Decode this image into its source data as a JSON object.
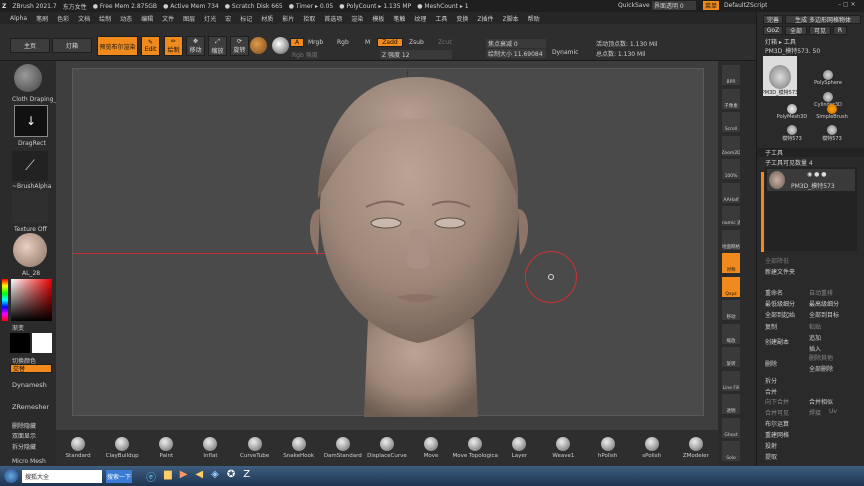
{
  "title_bar": {
    "title": "ZBrush 2021.7",
    "doc_name": "东方女性",
    "free_mem": "● Free Mem 2.875GB",
    "active_mem": "● Active Mem 734",
    "scratch_disk": "● Scratch Disk 665",
    "timer": "● Timer ▸ 0.05",
    "poly_count": "● PolyCount ▸ 1.135 MP",
    "mesh_count": "● MeshCount ▸ 1",
    "quicksave": "QuickSave",
    "interface_transparency": "界面透明 0",
    "menu_label": "菜单",
    "default_zscript": "DefaultZScript"
  },
  "menus": [
    "Alpha",
    "笔刷",
    "色彩",
    "文档",
    "绘制",
    "动态",
    "编辑",
    "文件",
    "图层",
    "灯光",
    "宏",
    "标记",
    "材质",
    "影片",
    "拾取",
    "首选项",
    "渲染",
    "模板",
    "笔触",
    "纹理",
    "工具",
    "变换",
    "Z插件",
    "Z脚本",
    "帮助"
  ],
  "toolbar": {
    "home": "主页",
    "lightbox": "灯箱",
    "preview_bool": "预览布尔渲染",
    "edit": "Edit",
    "draw": "绘制",
    "move": "移动",
    "scale": "缩放",
    "rotate": "旋转",
    "a": "A",
    "mrgb": "Mrgb",
    "rgb": "Rgb",
    "m": "M",
    "zadd": "Zadd",
    "zsub": "Zsub",
    "zcut": "Zcut",
    "rgb_intensity": "Rgb 强度",
    "z_intensity": "Z 强度 12",
    "focal_shift": "焦点衰减 0",
    "draw_size": "绘制大小 11.69084",
    "dynamic": "Dynamic",
    "active_points": "活动顶点数: 1.130 Mil",
    "total_points": "总点数: 1.130 Mil"
  },
  "left_panel": {
    "material": "Cloth Draping_T",
    "stroke": "DragRect",
    "alpha": "~BrushAlpha",
    "texture": "Texture Off",
    "material2": "AL_28",
    "gradient": "渐变",
    "switch_color": "切换颜色",
    "alternate": "交替",
    "dynamesh": "Dynamesh",
    "zremesher": "ZRemesher",
    "delete_hidden": "删除隐藏",
    "double_display": "双面显示",
    "split_hidden": "拆分隐藏",
    "micro_mesh": "Micro Mesh"
  },
  "right_toolbar": [
    "BPR",
    "子像素",
    "Scroll",
    "Zoom2D",
    "100%",
    "AAHalf",
    "Dynamic 透视",
    "地面网格",
    "对称",
    "Qxyz",
    "移动",
    "缩放",
    "旋转",
    "Line Fill",
    "透明",
    "Ghost",
    "Solo"
  ],
  "tool_panel": {
    "complete": "完善",
    "gen_multi": "生成 多边形网格物体",
    "goz": "GoZ",
    "all": "全部",
    "visible": "可见",
    "r": "R",
    "lightbox_tool": "灯箱 ▸ 工具",
    "current_tool": "PM3D_模特573. 50",
    "slider_value": "50",
    "tools": [
      {
        "name": "PM3D_模特573",
        "icon": "head"
      },
      {
        "name": "PolySphere",
        "icon": "sphere"
      },
      {
        "name": "Cylinder3D",
        "icon": "cylinder"
      },
      {
        "name": "PolyMesh3D",
        "icon": "star"
      },
      {
        "name": "SimpleBrush",
        "icon": "s-brush"
      },
      {
        "name": "模特573",
        "icon": "head"
      },
      {
        "name": "模特573",
        "icon": "head"
      }
    ],
    "subtool_header": "子工具",
    "subtool_visible": "子工具可见数量 4",
    "subtool_item": "PM3D_模特573",
    "all_low": "全部降低",
    "all_high": "全部升高",
    "new_folder": "新建文件夹",
    "rename": "重命名",
    "auto_reorder": "自动重排",
    "all_low2": "全部降低",
    "all_high2": "最高级细分",
    "lowest_sub": "最低级细分",
    "highest_sub": "最高级细分",
    "all_to_start": "全部到起始",
    "all_to_target": "全部到目标",
    "copy": "复制",
    "paste": "粘贴",
    "create_copy": "创建副本",
    "append": "追加",
    "insert": "插入",
    "delete": "删除",
    "delete_other": "删除其他",
    "delete_all": "全部删除",
    "split": "拆分",
    "merge": "合并",
    "merge_down": "向下合并",
    "merge_similar": "合并相似",
    "merge_visible": "合并可见",
    "weld": "焊接",
    "uv": "Uv",
    "boolean": "布尔运算",
    "remesh": "重建网格",
    "project": "投射",
    "extract": "提取"
  },
  "brushes": [
    "Standard",
    "ClayBuildup",
    "Paint",
    "Inflat",
    "CurveTube",
    "SnakeHook",
    "DamStandard",
    "DisplaceCurve",
    "Move",
    "Move Topologica",
    "Layer",
    "Weave1",
    "hPolish",
    "sPolish",
    "ZModeler"
  ],
  "taskbar": {
    "search_placeholder": "搜索一下",
    "baidu": "搜狐大全",
    "search_btn": "搜索一下"
  }
}
